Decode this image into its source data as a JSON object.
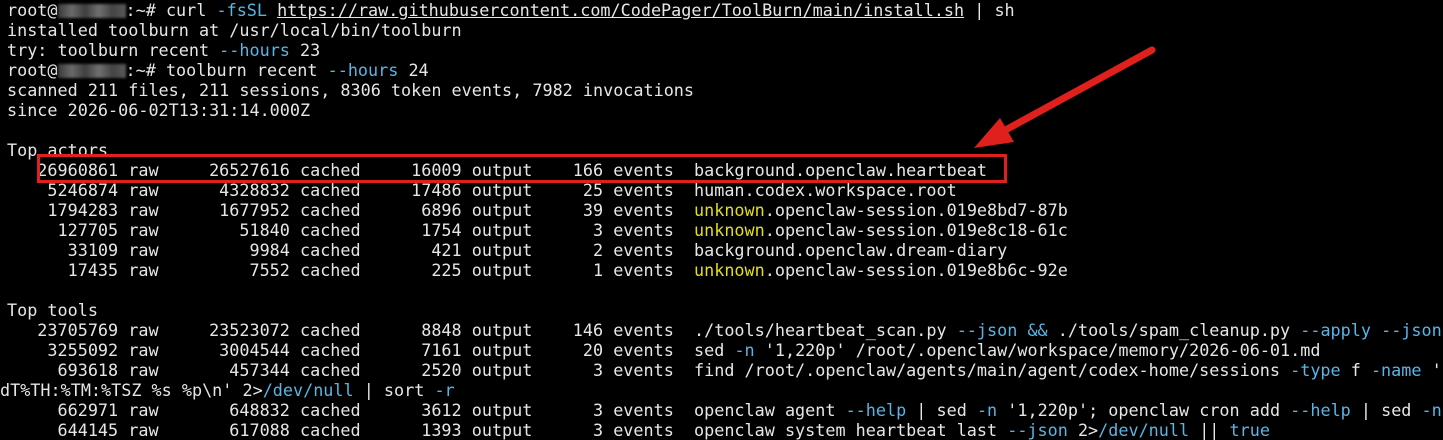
{
  "prompt": {
    "user": "root@",
    "suffix": ":~# "
  },
  "cmd1": {
    "curl": "curl ",
    "flag": "-fsSL",
    "url": "https://raw.githubusercontent.com/CodePager/ToolBurn/main/install.sh",
    "pipe": " | sh"
  },
  "install_msg": "installed toolburn at /usr/local/bin/toolburn",
  "try_msg": {
    "pre": "try: toolburn recent ",
    "flag": "--hours",
    "val": " 23"
  },
  "cmd2": {
    "pre": "toolburn recent ",
    "flag": "--hours",
    "val": " 24"
  },
  "scan_summary": "scanned 211 files, 211 sessions, 8306 token events, 7982 invocations",
  "since": "since 2026-06-02T13:31:14.000Z",
  "actors": {
    "header": "Top actors",
    "rows": [
      {
        "nums": "   26960861 raw     26527616 cached     16009 output    166 events  ",
        "kw": "",
        "rest": "background.openclaw.heartbeat"
      },
      {
        "nums": "    5246874 raw      4328832 cached     17486 output     25 events  ",
        "kw": "",
        "rest": "human.codex.workspace.root"
      },
      {
        "nums": "    1794283 raw      1677952 cached      6896 output     39 events  ",
        "kw": "unknown",
        "rest": ".openclaw-session.019e8bd7-87b"
      },
      {
        "nums": "     127705 raw        51840 cached      1754 output      3 events  ",
        "kw": "unknown",
        "rest": ".openclaw-session.019e8c18-61c"
      },
      {
        "nums": "      33109 raw         9984 cached       421 output      2 events  ",
        "kw": "",
        "rest": "background.openclaw.dream-diary"
      },
      {
        "nums": "      17435 raw         7552 cached       225 output      1 events  ",
        "kw": "unknown",
        "rest": ".openclaw-session.019e8b6c-92e"
      }
    ]
  },
  "tools": {
    "header": "Top tools",
    "r1": {
      "nums": "   23705769 raw     23523072 cached      8848 output    146 events  ",
      "a": "./tools/heartbeat_scan.py ",
      "b": "--json",
      "c": " ",
      "d": "&&",
      "e": " ./tools/spam_cleanup.py ",
      "f": "--apply",
      "g": " ",
      "h": "--json"
    },
    "r2": {
      "nums": "    3255092 raw      3004544 cached      7161 output     20 events  ",
      "a": "sed ",
      "b": "-n",
      "c": " '1,220p' /root/.openclaw/workspace/memory/2026-06-01.md"
    },
    "r3": {
      "nums": "     693618 raw       457344 cached      2520 output      3 events  ",
      "a": "find /root/.openclaw/agents/main/agent/codex-home/sessions ",
      "b": "-type",
      "c": " f ",
      "d": "-name",
      "e": " '"
    },
    "r3cont": {
      "a": "dT%TH:%TM:%TSZ %s %p\\n' 2>",
      "b": "/dev/null",
      "c": " | sort ",
      "d": "-r"
    },
    "r4": {
      "nums": "     662971 raw       648832 cached      3612 output      3 events  ",
      "a": "openclaw agent ",
      "b": "--help",
      "c": " | sed ",
      "d": "-n",
      "e": " '1,220p'; openclaw cron add ",
      "f": "--help",
      "g": " | sed ",
      "h": "-n"
    },
    "r5": {
      "nums": "     644145 raw       617088 cached      1393 output      3 events  ",
      "a": "openclaw system heartbeat last ",
      "b": "--json",
      "c": " 2>",
      "d": "/dev/null",
      "e": " || ",
      "f": "true"
    }
  },
  "colors": {
    "background": "#000000",
    "text": "#e6e6e6",
    "flag": "#59b5e6",
    "keyword": "#e3df14",
    "annotation": "#e0201c"
  }
}
